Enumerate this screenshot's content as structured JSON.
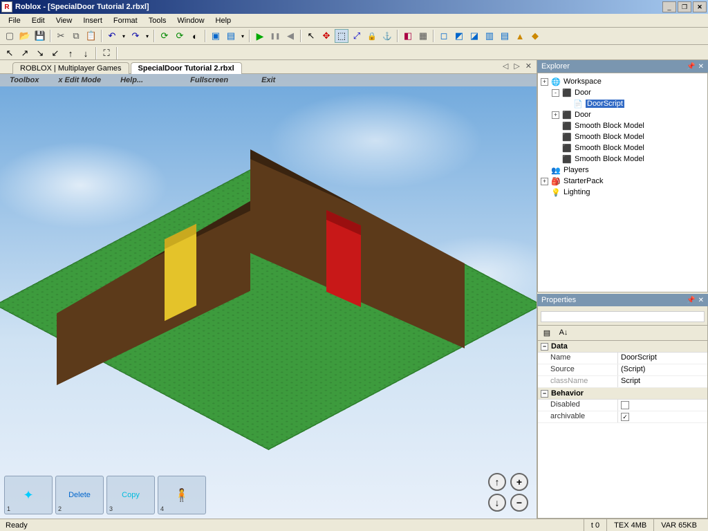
{
  "title": "Roblox - [SpecialDoor Tutorial 2.rbxl]",
  "menu": [
    "File",
    "Edit",
    "View",
    "Insert",
    "Format",
    "Tools",
    "Window",
    "Help"
  ],
  "tabs": [
    {
      "label": "ROBLOX | Multiplayer Games",
      "active": false
    },
    {
      "label": "SpecialDoor Tutorial 2.rbxl",
      "active": true
    }
  ],
  "viewportMenu": [
    "Toolbox",
    "x Edit Mode",
    "Help...",
    "Fullscreen",
    "Exit"
  ],
  "bottomTools": [
    {
      "num": "1",
      "label": ""
    },
    {
      "num": "2",
      "label": "Delete"
    },
    {
      "num": "3",
      "label": "Copy"
    },
    {
      "num": "4",
      "label": ""
    }
  ],
  "explorer": {
    "title": "Explorer",
    "tree": [
      {
        "indent": 0,
        "toggle": "+",
        "icon": "🌐",
        "label": "Workspace",
        "sel": false
      },
      {
        "indent": 1,
        "toggle": "-",
        "icon": "⬛",
        "label": "Door",
        "sel": false,
        "iconColor": "#bbb"
      },
      {
        "indent": 2,
        "toggle": "",
        "icon": "📄",
        "label": "DoorScript",
        "sel": true
      },
      {
        "indent": 1,
        "toggle": "+",
        "icon": "⬛",
        "label": "Door",
        "sel": false,
        "iconColor": "#bbb"
      },
      {
        "indent": 1,
        "toggle": "",
        "icon": "⬛",
        "label": "Smooth Block Model",
        "iconColor": "#bbb"
      },
      {
        "indent": 1,
        "toggle": "",
        "icon": "⬛",
        "label": "Smooth Block Model",
        "iconColor": "#bbb"
      },
      {
        "indent": 1,
        "toggle": "",
        "icon": "⬛",
        "label": "Smooth Block Model",
        "iconColor": "#bbb"
      },
      {
        "indent": 1,
        "toggle": "",
        "icon": "⬛",
        "label": "Smooth Block Model",
        "iconColor": "#bbb"
      },
      {
        "indent": 0,
        "toggle": "",
        "icon": "👥",
        "label": "Players",
        "iconColor": "#fa0"
      },
      {
        "indent": 0,
        "toggle": "+",
        "icon": "🎒",
        "label": "StarterPack"
      },
      {
        "indent": 0,
        "toggle": "",
        "icon": "💡",
        "label": "Lighting"
      }
    ]
  },
  "properties": {
    "title": "Properties",
    "categories": [
      {
        "name": "Data",
        "rows": [
          {
            "name": "Name",
            "value": "DoorScript"
          },
          {
            "name": "Source",
            "value": "(Script)"
          },
          {
            "name": "className",
            "value": "Script",
            "readonly": true
          }
        ]
      },
      {
        "name": "Behavior",
        "rows": [
          {
            "name": "Disabled",
            "checkbox": true,
            "checked": false
          },
          {
            "name": "archivable",
            "checkbox": true,
            "checked": true
          }
        ]
      }
    ]
  },
  "status": {
    "left": "Ready",
    "t": "t 0",
    "tex": "TEX 4MB",
    "var": "VAR 65KB"
  }
}
